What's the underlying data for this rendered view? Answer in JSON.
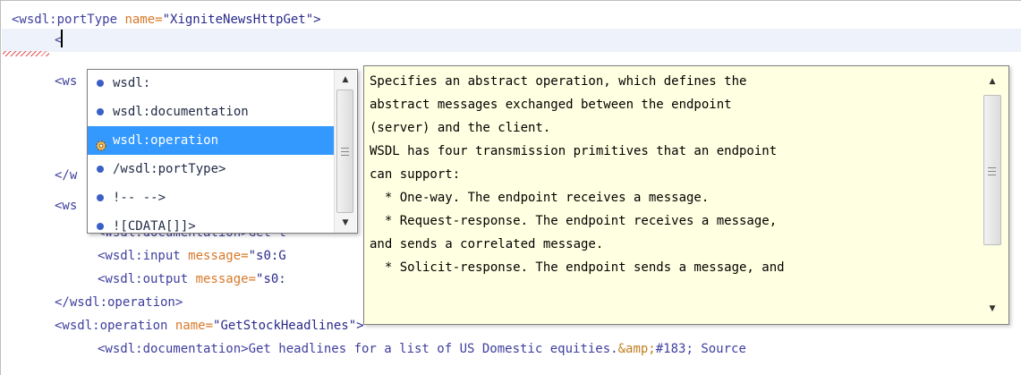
{
  "editor": {
    "lines": [
      {
        "parts": [
          {
            "t": "<wsdl:portType ",
            "c": "tag"
          },
          {
            "t": "name=",
            "c": "attr"
          },
          {
            "t": "\"XigniteNewsHttpGet\">",
            "c": "val"
          }
        ]
      },
      {
        "parts": [
          {
            "t": "<",
            "c": "tag"
          }
        ]
      },
      {
        "parts": [
          {
            "t": "<ws",
            "c": "tag"
          }
        ]
      },
      {
        "parts": [
          {
            "t": "",
            "c": "tag"
          }
        ]
      },
      {
        "parts": [
          {
            "t": "",
            "c": "tag"
          }
        ]
      },
      {
        "parts": [
          {
            "t": "</w",
            "c": "tag"
          }
        ]
      },
      {
        "parts": [
          {
            "t": "<ws",
            "c": "tag"
          }
        ]
      },
      {
        "parts": [
          {
            "t": "<wsdl:documentation>Get l",
            "c": "tag"
          }
        ]
      },
      {
        "parts": [
          {
            "t": "<wsdl:input ",
            "c": "tag"
          },
          {
            "t": "message=",
            "c": "attr"
          },
          {
            "t": "\"s0:G",
            "c": "val"
          }
        ]
      },
      {
        "parts": [
          {
            "t": "<wsdl:output ",
            "c": "tag"
          },
          {
            "t": "message=",
            "c": "attr"
          },
          {
            "t": "\"s0:",
            "c": "val"
          }
        ]
      },
      {
        "parts": [
          {
            "t": "</wsdl:operation>",
            "c": "tag"
          }
        ]
      },
      {
        "parts": [
          {
            "t": "<wsdl:operation ",
            "c": "tag"
          },
          {
            "t": "name=",
            "c": "attr"
          },
          {
            "t": "\"GetStockHeadlines\">",
            "c": "val"
          }
        ]
      },
      {
        "parts": [
          {
            "t": "<wsdl:documentation>Get headlines for a list of US Domestic equities.",
            "c": "tag"
          },
          {
            "t": "&amp;",
            "c": "ent"
          },
          {
            "t": "#183; Source",
            "c": "tag"
          }
        ]
      }
    ]
  },
  "completion": {
    "items": [
      {
        "label": "wsdl:",
        "icon": "element-icon"
      },
      {
        "label": "wsdl:documentation",
        "icon": "element-icon"
      },
      {
        "label": "wsdl:operation",
        "icon": "operation-gear-icon",
        "selected": true
      },
      {
        "label": "/wsdl:portType>",
        "icon": "element-icon"
      },
      {
        "label": "!--  -->",
        "icon": "element-icon"
      },
      {
        "label": "![CDATA[]]>",
        "icon": "element-icon"
      }
    ],
    "scroll_position": 0.0
  },
  "documentation": {
    "lines": [
      "Specifies an abstract operation, which defines the",
      "abstract messages exchanged between the endpoint",
      "(server) and the client.",
      "WSDL has four transmission primitives that an endpoint",
      "can support:",
      "  * One-way. The endpoint receives a message.",
      "  * Request-response. The endpoint receives a message,",
      "and sends a correlated message.",
      "  * Solicit-response. The endpoint sends a message, and"
    ]
  },
  "colors": {
    "tag": "#3f3f9f",
    "attr": "#d8792a",
    "selection": "#3399ff",
    "tooltip_bg": "#ffffe1"
  }
}
